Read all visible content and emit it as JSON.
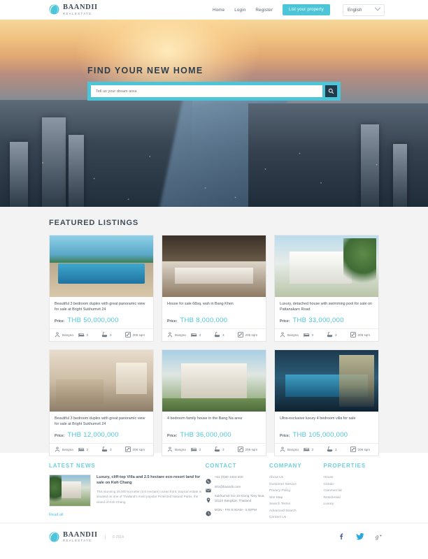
{
  "brand": {
    "name": "BAANDII",
    "tagline": "REALESTATE"
  },
  "header": {
    "nav": [
      {
        "label": "Home",
        "name": "nav-home"
      },
      {
        "label": "Login",
        "name": "nav-login"
      },
      {
        "label": "Register",
        "name": "nav-register"
      }
    ],
    "cta_label": "List your property",
    "language": "English"
  },
  "hero": {
    "title": "FIND YOUR NEW HOME",
    "search_placeholder": "Tell us your dream area",
    "search_value": "",
    "search_icon": "search-icon"
  },
  "featured": {
    "title": "FEATURED LISTINGS",
    "price_label": "Price:",
    "listings": [
      {
        "title": "Beautiful 3 bedroom duplex with great panoramic view for sale at Bright Sukhumvit 24",
        "price": "THB 50,000,000",
        "location": "Bangna",
        "beds": "3",
        "baths": "3",
        "area": "208 sqm",
        "photo": "ph-pool"
      },
      {
        "title": "House for sale 68sq. wah in Bang Khen",
        "price": "THB 8,000,000",
        "location": "Bangna",
        "beds": "3",
        "baths": "3",
        "area": "208 sqm",
        "photo": "ph-kitchen"
      },
      {
        "title": "Luxury, detached house with swimming pool for sale on Pattanakarn Road",
        "price": "THB 33,000,000",
        "location": "Bangna",
        "beds": "3",
        "baths": "3",
        "area": "208 sqm",
        "photo": "ph-villa"
      },
      {
        "title": "Beautiful 3 bedroom duplex with great panoramic view for sale at Bright Sukhumvit 24",
        "price": "THB 12,000,000",
        "location": "Bangna",
        "beds": "3",
        "baths": "3",
        "area": "208 sqm",
        "photo": "ph-living"
      },
      {
        "title": "4 bedroom family house in the Bang Na area",
        "price": "THB 36,000,000",
        "location": "Bangna",
        "beds": "3",
        "baths": "3",
        "area": "208 sqm",
        "photo": "ph-house"
      },
      {
        "title": "Ultra-exclusive luxury 4 bedroom villa for sale",
        "price": "THB 105,000,000",
        "location": "Bangna",
        "beds": "3",
        "baths": "3",
        "area": "208 sqm",
        "photo": "ph-night"
      }
    ]
  },
  "footer": {
    "news": {
      "heading": "LATEST NEWS",
      "article_title": "Luxury, cliff-top Villa and 2.5 hectare eco-resort land for sale on Koh Chang",
      "article_excerpt": "This stunning 25,000 sq meter (2.5 Hectare) ocean front, tropical estate is situated on one of Thailand's most popular Protected Natural Parks, the island of Koh Chang.",
      "read_all": "Read all"
    },
    "contact": {
      "heading": "CONTACT",
      "phone": "+61 (0)80 4464 600",
      "email": "info@baandii.com",
      "address": "Sukhumvit Soi 13 Klong Toey Nua, 10110 Bangkok, Thailand",
      "hours": "MON - FRI 9:00AM - 5:00PM"
    },
    "company": {
      "heading": "COMPANY",
      "links": [
        "About Us",
        "Customer Service",
        "Privacy Policy",
        "Site Map",
        "Search Terms",
        "Advanced Search",
        "Contact Us"
      ]
    },
    "properties": {
      "heading": "PROPERTIES",
      "links": [
        "House",
        "Condo",
        "Commercial",
        "Residential",
        "Luxury"
      ]
    }
  },
  "bottom": {
    "copyright": "© 2014",
    "socials": [
      {
        "name": "facebook-icon",
        "glyph": "f"
      },
      {
        "name": "twitter-icon",
        "glyph": "t"
      },
      {
        "name": "googleplus-icon",
        "glyph": "g+"
      }
    ]
  },
  "colors": {
    "accent": "#4cc5d9",
    "heading": "#3f4c58",
    "muted": "#97a0a9"
  }
}
